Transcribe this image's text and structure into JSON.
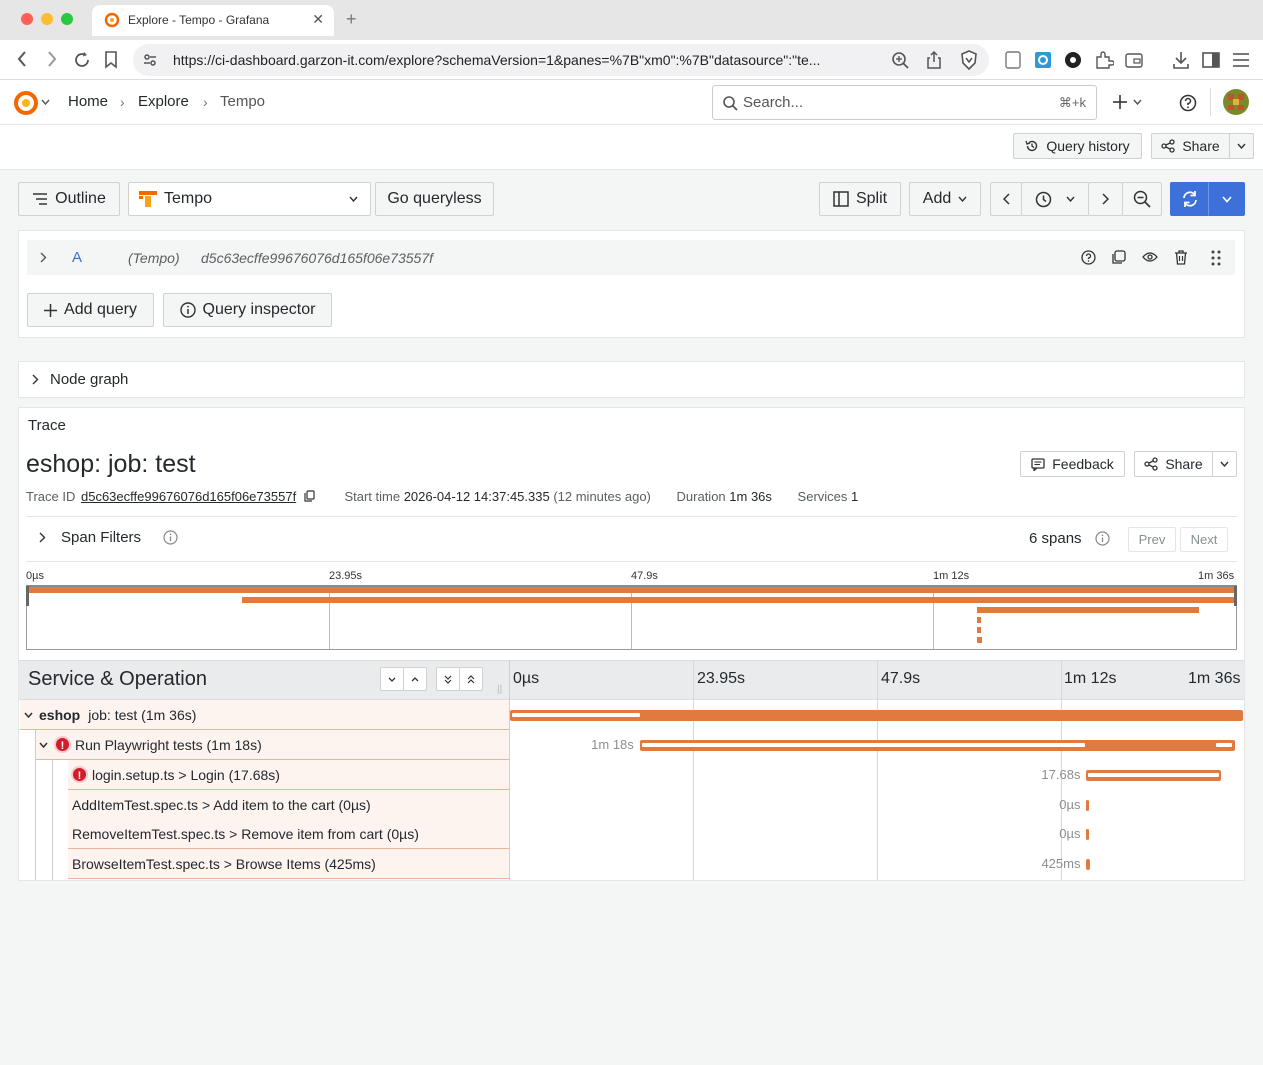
{
  "browser": {
    "tab_title": "Explore - Tempo - Grafana",
    "url": "https://ci-dashboard.garzon-it.com/explore?schemaVersion=1&panes=%7B\"xm0\":%7B\"datasource\":\"te..."
  },
  "topbar": {
    "breadcrumb": [
      "Home",
      "Explore",
      "Tempo"
    ],
    "search_placeholder": "Search...",
    "search_shortcut": "⌘+k"
  },
  "toolbar": {
    "query_history": "Query history",
    "share": "Share"
  },
  "explore": {
    "outline": "Outline",
    "datasource": "Tempo",
    "go_queryless": "Go queryless",
    "split": "Split",
    "add": "Add"
  },
  "query": {
    "ref": "A",
    "ds": "(Tempo)",
    "trace_id": "d5c63ecffe99676076d165f06e73557f",
    "add_query": "Add query",
    "query_inspector": "Query inspector"
  },
  "node_graph": {
    "label": "Node graph"
  },
  "trace": {
    "panel_title": "Trace",
    "title": "eshop: job: test",
    "feedback": "Feedback",
    "share": "Share",
    "trace_id_label": "Trace ID",
    "trace_id": "d5c63ecffe99676076d165f06e73557f",
    "start_label": "Start time",
    "start": "2026-04-12 14:37:45.335",
    "start_rel": "(12 minutes ago)",
    "duration_label": "Duration",
    "duration": "1m 36s",
    "services_label": "Services",
    "services": "1",
    "span_filters": "Span Filters",
    "spans": "6 spans",
    "prev": "Prev",
    "next": "Next",
    "mini_ticks": [
      "0µs",
      "23.95s",
      "47.9s",
      "1m 12s",
      "1m 36s"
    ],
    "header": "Service & Operation",
    "ticks": [
      "0µs",
      "23.95s",
      "47.9s",
      "1m 12s",
      "1m 36s"
    ]
  },
  "spans": [
    {
      "service": "eshop",
      "label": "job: test (1m 36s)",
      "duration_label": "",
      "start": 0,
      "duration": 96,
      "error": false,
      "depth": 0
    },
    {
      "service": "",
      "label": "Run Playwright tests (1m 18s)",
      "duration_label": "1m 18s",
      "start": 17,
      "duration": 78,
      "error": true,
      "depth": 1
    },
    {
      "service": "",
      "label": "login.setup.ts > Login (17.68s)",
      "duration_label": "17.68s",
      "start": 75.5,
      "duration": 17.68,
      "error": true,
      "depth": 2
    },
    {
      "service": "",
      "label": "AddItemTest.spec.ts > Add item to the cart (0µs)",
      "duration_label": "0µs",
      "start": 75.5,
      "duration": 0,
      "error": false,
      "depth": 2
    },
    {
      "service": "",
      "label": "RemoveItemTest.spec.ts > Remove item from cart (0µs)",
      "duration_label": "0µs",
      "start": 75.5,
      "duration": 0,
      "error": false,
      "depth": 2
    },
    {
      "service": "",
      "label": "BrowseItemTest.spec.ts > Browse Items (425ms)",
      "duration_label": "425ms",
      "start": 75.5,
      "duration": 0.425,
      "error": false,
      "depth": 2
    }
  ],
  "colors": {
    "span": "#e07a3f",
    "primary": "#3d71d9",
    "error": "#d11d2a"
  }
}
